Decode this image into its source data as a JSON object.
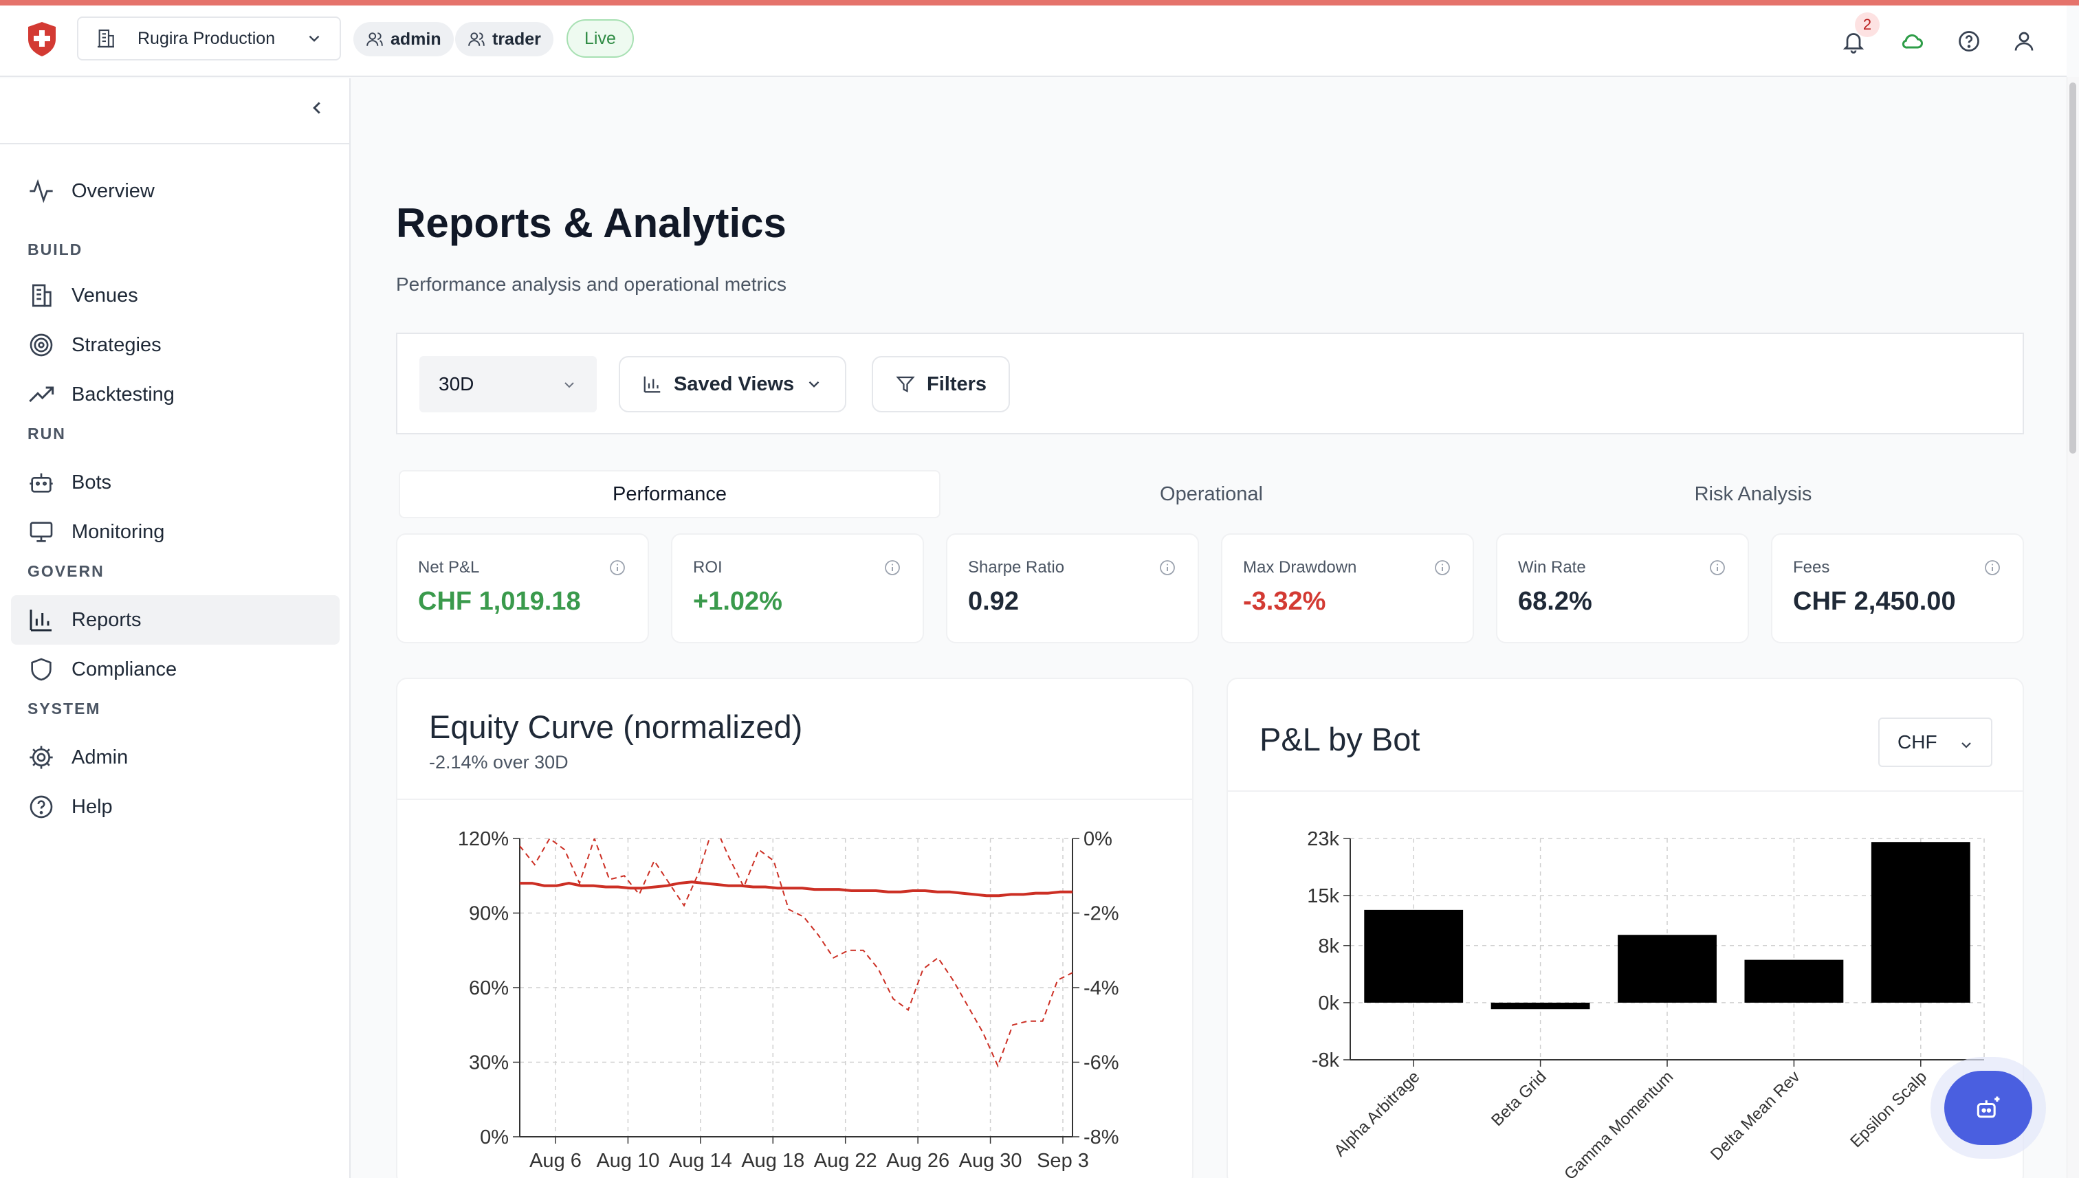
{
  "topbar": {
    "workspace": "Rugira Production",
    "role_admin": "admin",
    "role_trader": "trader",
    "live": "Live",
    "notification_count": "2"
  },
  "sidebar": {
    "overview": "Overview",
    "section_build": "BUILD",
    "venues": "Venues",
    "strategies": "Strategies",
    "backtesting": "Backtesting",
    "section_run": "RUN",
    "bots": "Bots",
    "monitoring": "Monitoring",
    "section_govern": "GOVERN",
    "reports": "Reports",
    "compliance": "Compliance",
    "section_system": "SYSTEM",
    "admin": "Admin",
    "help": "Help"
  },
  "page": {
    "title": "Reports & Analytics",
    "subtitle": "Performance analysis and operational metrics"
  },
  "filters": {
    "period": "30D",
    "saved_views": "Saved Views",
    "filters": "Filters"
  },
  "tabs": [
    "Performance",
    "Operational",
    "Risk Analysis"
  ],
  "kpis": [
    {
      "label": "Net P&L",
      "value": "CHF 1,019.18",
      "color": "#3a9a4c"
    },
    {
      "label": "ROI",
      "value": "+1.02%",
      "color": "#3a9a4c"
    },
    {
      "label": "Sharpe Ratio",
      "value": "0.92",
      "color": "#1f2937"
    },
    {
      "label": "Max Drawdown",
      "value": "-3.32%",
      "color": "#d33a33"
    },
    {
      "label": "Win Rate",
      "value": "68.2%",
      "color": "#1f2937"
    },
    {
      "label": "Fees",
      "value": "CHF 2,450.00",
      "color": "#1f2937"
    }
  ],
  "equity_card": {
    "title": "Equity Curve (normalized)",
    "subtitle": "-2.14% over 30D"
  },
  "pnl_card": {
    "title": "P&L by Bot",
    "currency": "CHF"
  },
  "chart_data": [
    {
      "type": "line",
      "title": "Equity Curve (normalized)",
      "x_ticks": [
        "Aug 6",
        "Aug 10",
        "Aug 14",
        "Aug 18",
        "Aug 22",
        "Aug 26",
        "Aug 30",
        "Sep 3"
      ],
      "y_left_ticks": [
        "0%",
        "30%",
        "60%",
        "90%",
        "120%"
      ],
      "y_right_ticks": [
        "-8%",
        "-6%",
        "-4%",
        "-2%",
        "0%"
      ],
      "ylim_left": [
        0,
        120
      ],
      "ylim_right": [
        -8,
        0
      ],
      "grid": true,
      "series": [
        {
          "style": "solid",
          "color": "#cc2f24",
          "axis": "left",
          "values": [
            102,
            102,
            101,
            101,
            102,
            101,
            101,
            100.5,
            100.5,
            100,
            100,
            100.5,
            101,
            102,
            102.5,
            102,
            101.5,
            101,
            101,
            100.5,
            100.5,
            100,
            100,
            100,
            99.5,
            99.5,
            99.5,
            99,
            99,
            99,
            98.5,
            98.5,
            99,
            99,
            98.5,
            98.5,
            98,
            97.5,
            97,
            97,
            97.5,
            97.5,
            98,
            98,
            98.5,
            98.5
          ]
        },
        {
          "style": "dashed",
          "color": "#cc2f24",
          "axis": "right",
          "values": [
            -0.2,
            -0.7,
            0,
            -0.3,
            -1.2,
            0,
            -1.1,
            -1.0,
            -1.5,
            -0.6,
            -1.2,
            -1.8,
            -0.9,
            0.4,
            -0.5,
            -1.3,
            -0.3,
            -0.6,
            -1.9,
            -2.1,
            -2.6,
            -3.2,
            -3.0,
            -3.0,
            -3.5,
            -4.3,
            -4.6,
            -3.5,
            -3.2,
            -3.8,
            -4.5,
            -5.2,
            -6.1,
            -5.0,
            -4.9,
            -4.9,
            -3.8,
            -3.6
          ]
        }
      ]
    },
    {
      "type": "bar",
      "title": "P&L by Bot",
      "categories": [
        "Alpha Arbitrage",
        "Beta Grid",
        "Gamma Momentum",
        "Delta Mean Rev",
        "Epsilon Scalp"
      ],
      "values": [
        13000,
        -900,
        9500,
        6000,
        22500
      ],
      "ylim": [
        -8000,
        23000
      ],
      "y_ticks": [
        "-8k",
        "0k",
        "8k",
        "15k",
        "23k"
      ],
      "y_tick_values": [
        -8000,
        0,
        8000,
        15000,
        23000
      ],
      "bar_color": "#000000",
      "grid": true
    }
  ],
  "colors": {
    "accent": "#d33a33",
    "positive": "#3a9a4c",
    "negative": "#d33a33",
    "fab": "#4a5fe0"
  }
}
